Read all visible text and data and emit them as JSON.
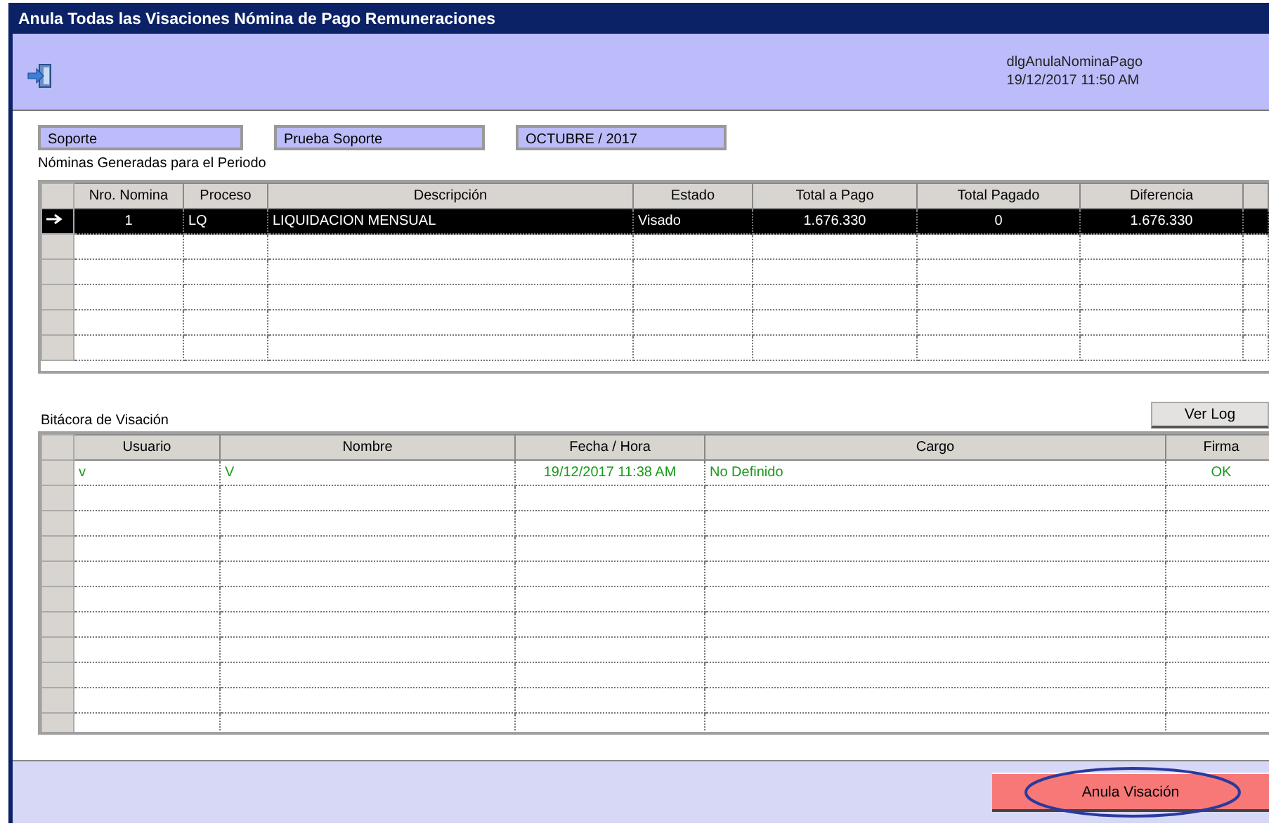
{
  "window": {
    "title": "Anula Todas las Visaciones Nómina de Pago Remuneraciones"
  },
  "header": {
    "dialog_id": "dlgAnulaNominaPago",
    "datetime": "19/12/2017 11:50 AM"
  },
  "fields": [
    "Soporte",
    "Prueba Soporte",
    "OCTUBRE / 2017"
  ],
  "payrolls": {
    "label": "Nóminas Generadas para el Periodo",
    "columns": [
      "Nro. Nomina",
      "Proceso",
      "Descripción",
      "Estado",
      "Total a Pago",
      "Total Pagado",
      "Diferencia"
    ],
    "rows": [
      {
        "selected": true,
        "cells": [
          "1",
          "LQ",
          "LIQUIDACION MENSUAL",
          "Visado",
          "1.676.330",
          "0",
          "1.676.330"
        ]
      }
    ]
  },
  "log": {
    "label": "Bitácora de Visación",
    "button": "Ver Log",
    "columns": [
      "Usuario",
      "Nombre",
      "Fecha / Hora",
      "Cargo",
      "Firma"
    ],
    "rows": [
      {
        "cells": [
          "v",
          "V",
          "19/12/2017 11:38 AM",
          "No Definido",
          "OK"
        ]
      }
    ]
  },
  "action_button": {
    "label": "Anula Visación",
    "highlighted": true
  }
}
